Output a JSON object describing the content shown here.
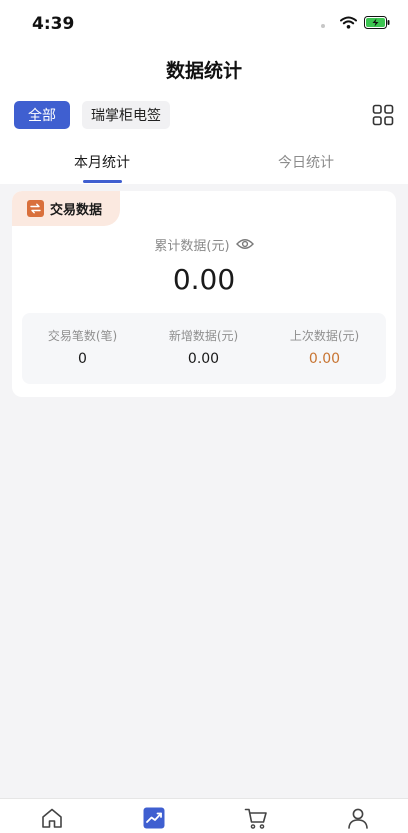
{
  "status_bar": {
    "time": "4:39",
    "icons": [
      "wifi-icon",
      "battery-charging-icon"
    ],
    "battery_color": "#3cc451"
  },
  "header": {
    "title": "数据统计"
  },
  "filters": {
    "chips": [
      {
        "label": "全部",
        "selected": true
      },
      {
        "label": "瑞掌柜电签",
        "selected": false
      }
    ],
    "grid_icon": "grid-icon"
  },
  "tabs": [
    {
      "label": "本月统计",
      "active": true
    },
    {
      "label": "今日统计",
      "active": false
    }
  ],
  "card": {
    "badge": "交易数据",
    "badge_icon": "swap-icon",
    "total_label": "累计数据(元)",
    "total_value": "0.00",
    "eye_icon": "eye-icon",
    "stats": [
      {
        "label": "交易笔数(笔)",
        "value": "0"
      },
      {
        "label": "新增数据(元)",
        "value": "0.00"
      },
      {
        "label": "上次数据(元)",
        "value": "0.00"
      }
    ]
  },
  "bottom_tabs": [
    {
      "icon": "home-icon",
      "active": false
    },
    {
      "icon": "chart-icon",
      "active": true
    },
    {
      "icon": "cart-icon",
      "active": false
    },
    {
      "icon": "user-icon",
      "active": false
    }
  ],
  "colors": {
    "accent": "#3f5fd0",
    "badge_bg": "#fbe9e0",
    "badge_icon": "#d9703c",
    "highlight_value": "#c87533",
    "page_bg": "#f4f4f6"
  }
}
